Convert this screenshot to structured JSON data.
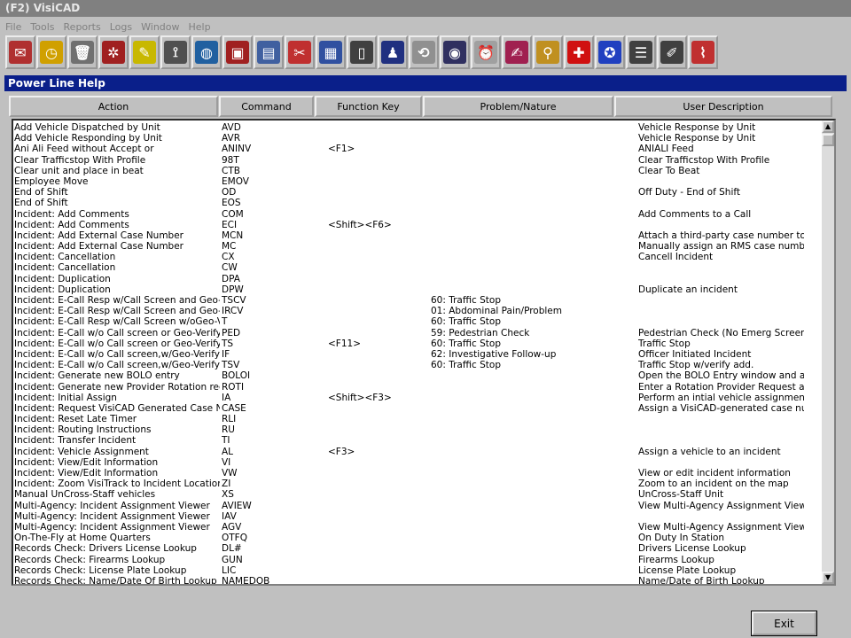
{
  "window": {
    "title": "(F2)  VisiCAD"
  },
  "menu": [
    "File",
    "Tools",
    "Reports",
    "Logs",
    "Window",
    "Help"
  ],
  "toolbar_icons": [
    {
      "name": "dispatch-icon",
      "glyph": "✉",
      "color": "#b03030"
    },
    {
      "name": "clock-icon",
      "glyph": "◷",
      "color": "#d0a000"
    },
    {
      "name": "trash-icon",
      "glyph": "🗑",
      "color": "#707070"
    },
    {
      "name": "network-icon",
      "glyph": "✲",
      "color": "#a02020"
    },
    {
      "name": "highlighter-icon",
      "glyph": "✎",
      "color": "#c8b800"
    },
    {
      "name": "radio-tower-icon",
      "glyph": "⟟",
      "color": "#505050"
    },
    {
      "name": "globe-icon",
      "glyph": "◍",
      "color": "#2060a0"
    },
    {
      "name": "station-icon",
      "glyph": "▣",
      "color": "#a02020"
    },
    {
      "name": "files-icon",
      "glyph": "▤",
      "color": "#4060a0"
    },
    {
      "name": "tools-icon",
      "glyph": "✂",
      "color": "#c03030"
    },
    {
      "name": "report-icon",
      "glyph": "▦",
      "color": "#3050a0"
    },
    {
      "name": "book-icon",
      "glyph": "▯",
      "color": "#404040"
    },
    {
      "name": "people-icon",
      "glyph": "♟",
      "color": "#203080"
    },
    {
      "name": "recycle-icon",
      "glyph": "⟲",
      "color": "#909090"
    },
    {
      "name": "eye-icon",
      "glyph": "◉",
      "color": "#303060"
    },
    {
      "name": "alarm-icon",
      "glyph": "⏰",
      "color": "#a0a0a0"
    },
    {
      "name": "edit-icon",
      "glyph": "✍",
      "color": "#a02050"
    },
    {
      "name": "search-person-icon",
      "glyph": "⚲",
      "color": "#c09020"
    },
    {
      "name": "medical-cross-icon",
      "glyph": "✚",
      "color": "#d01010"
    },
    {
      "name": "police-badge-icon",
      "glyph": "✪",
      "color": "#2040c0"
    },
    {
      "name": "list-icon",
      "glyph": "☰",
      "color": "#404040"
    },
    {
      "name": "document-pen-icon",
      "glyph": "✐",
      "color": "#404040"
    },
    {
      "name": "chart-icon",
      "glyph": "⌇",
      "color": "#c03030"
    }
  ],
  "panel": {
    "title": "Power Line Help"
  },
  "columns": [
    "Action",
    "Command",
    "Function Key",
    "Problem/Nature",
    "User Description"
  ],
  "rows": [
    {
      "action": "Add Vehicle Dispatched by Unit",
      "command": "AVD",
      "fkey": "",
      "problem": "",
      "desc": "Vehicle Response by Unit"
    },
    {
      "action": "Add Vehicle Responding by Unit",
      "command": "AVR",
      "fkey": "",
      "problem": "",
      "desc": "Vehicle Response by Unit"
    },
    {
      "action": "Ani Ali Feed without Accept or",
      "command": "ANINV",
      "fkey": "<F1>",
      "problem": "",
      "desc": "ANIALI Feed"
    },
    {
      "action": "Clear Trafficstop With Profile",
      "command": "98T",
      "fkey": "",
      "problem": "",
      "desc": "Clear Trafficstop With Profile"
    },
    {
      "action": "Clear unit and place in beat",
      "command": "CTB",
      "fkey": "",
      "problem": "",
      "desc": "Clear To Beat"
    },
    {
      "action": "Employee Move",
      "command": "EMOV",
      "fkey": "",
      "problem": "",
      "desc": ""
    },
    {
      "action": "End of Shift",
      "command": "OD",
      "fkey": "",
      "problem": "",
      "desc": "Off Duty - End of Shift"
    },
    {
      "action": "End of Shift",
      "command": "EOS",
      "fkey": "",
      "problem": "",
      "desc": ""
    },
    {
      "action": "Incident: Add Comments",
      "command": "COM",
      "fkey": "",
      "problem": "",
      "desc": "Add Comments to a Call"
    },
    {
      "action": "Incident: Add Comments",
      "command": "ECI",
      "fkey": "<Shift><F6>",
      "problem": "",
      "desc": ""
    },
    {
      "action": "Incident: Add External Case Number",
      "command": "MCN",
      "fkey": "",
      "problem": "",
      "desc": "Attach a third-party case number to an inc"
    },
    {
      "action": "Incident: Add External Case Number",
      "command": "MC",
      "fkey": "",
      "problem": "",
      "desc": "Manually assign an RMS case number to a"
    },
    {
      "action": "Incident: Cancellation",
      "command": "CX",
      "fkey": "",
      "problem": "",
      "desc": "Cancell Incident"
    },
    {
      "action": "Incident: Cancellation",
      "command": "CW",
      "fkey": "",
      "problem": "",
      "desc": ""
    },
    {
      "action": "Incident: Duplication",
      "command": "DPA",
      "fkey": "",
      "problem": "",
      "desc": ""
    },
    {
      "action": "Incident: Duplication",
      "command": "DPW",
      "fkey": "",
      "problem": "",
      "desc": "Duplicate an incident"
    },
    {
      "action": "Incident: E-Call Resp w/Call Screen and Geo-Verify",
      "command": "TSCV",
      "fkey": "",
      "problem": "60: Traffic Stop",
      "desc": ""
    },
    {
      "action": "Incident: E-Call Resp w/Call Screen and Geo-Verify",
      "command": "IRCV",
      "fkey": "",
      "problem": "01: Abdominal Pain/Problem",
      "desc": ""
    },
    {
      "action": "Incident: E-Call Resp w/Call Screen w/oGeo-Verify",
      "command": "T",
      "fkey": "",
      "problem": "60: Traffic Stop",
      "desc": ""
    },
    {
      "action": "Incident: E-Call w/o Call screen or Geo-Verify",
      "command": "PED",
      "fkey": "",
      "problem": "59: Pedestrian Check",
      "desc": "Pedestrian Check (No Emerg Screen or Ve"
    },
    {
      "action": "Incident: E-Call w/o Call screen or Geo-Verify",
      "command": "TS",
      "fkey": "<F11>",
      "problem": "60: Traffic Stop",
      "desc": "Traffic Stop"
    },
    {
      "action": "Incident: E-Call w/o Call screen,w/Geo-Verify",
      "command": "IF",
      "fkey": "",
      "problem": "62: Investigative Follow-up",
      "desc": "Officer Initiated Incident"
    },
    {
      "action": "Incident: E-Call w/o Call screen,w/Geo-Verify",
      "command": "TSV",
      "fkey": "",
      "problem": "60: Traffic Stop",
      "desc": "Traffic Stop w/verify add."
    },
    {
      "action": "Incident: Generate new BOLO entry",
      "command": "BOLOI",
      "fkey": "",
      "problem": "",
      "desc": "Open the BOLO Entry window and automa"
    },
    {
      "action": "Incident: Generate new Provider Rotation request",
      "command": "ROTI",
      "fkey": "",
      "problem": "",
      "desc": "Enter a Rotation Provider  Request and au"
    },
    {
      "action": "Incident: Initial Assign",
      "command": "IA",
      "fkey": "<Shift><F3>",
      "problem": "",
      "desc": "Perform an intial vehicle assignment"
    },
    {
      "action": "Incident: Request VisiCAD Generated Case Number",
      "command": "CASE",
      "fkey": "",
      "problem": "",
      "desc": "Assign a VisiCAD-generated case number"
    },
    {
      "action": "Incident: Reset Late Timer",
      "command": "RLI",
      "fkey": "",
      "problem": "",
      "desc": ""
    },
    {
      "action": "Incident: Routing Instructions",
      "command": "RU",
      "fkey": "",
      "problem": "",
      "desc": ""
    },
    {
      "action": "Incident: Transfer Incident",
      "command": "TI",
      "fkey": "",
      "problem": "",
      "desc": ""
    },
    {
      "action": "Incident: Vehicle Assignment",
      "command": "AL",
      "fkey": "<F3>",
      "problem": "",
      "desc": "Assign a vehicle to an incident"
    },
    {
      "action": "Incident: View/Edit Information",
      "command": "VI",
      "fkey": "",
      "problem": "",
      "desc": ""
    },
    {
      "action": "Incident: View/Edit Information",
      "command": "VW",
      "fkey": "",
      "problem": "",
      "desc": "View or edit incident information"
    },
    {
      "action": "Incident: Zoom VisiTrack to Incident Location",
      "command": "ZI",
      "fkey": "",
      "problem": "",
      "desc": "Zoom to an incident on the map"
    },
    {
      "action": "Manual UnCross-Staff vehicles",
      "command": "XS",
      "fkey": "",
      "problem": "",
      "desc": "UnCross-Staff Unit"
    },
    {
      "action": "Multi-Agency: Incident Assignment Viewer",
      "command": "AVIEW",
      "fkey": "",
      "problem": "",
      "desc": "View Multi-Agency Assignment Viewer"
    },
    {
      "action": "Multi-Agency: Incident Assignment Viewer",
      "command": "IAV",
      "fkey": "",
      "problem": "",
      "desc": ""
    },
    {
      "action": "Multi-Agency: Incident Assignment Viewer",
      "command": "AGV",
      "fkey": "",
      "problem": "",
      "desc": "View Multi-Agency Assignment Viewer"
    },
    {
      "action": "On-The-Fly at Home Quarters",
      "command": "OTFQ",
      "fkey": "",
      "problem": "",
      "desc": "On Duty In Station"
    },
    {
      "action": "Records Check: Drivers License Lookup",
      "command": "DL#",
      "fkey": "",
      "problem": "",
      "desc": "Drivers License Lookup"
    },
    {
      "action": "Records Check: Firearms Lookup",
      "command": "GUN",
      "fkey": "",
      "problem": "",
      "desc": "Firearms Lookup"
    },
    {
      "action": "Records Check: License Plate Lookup",
      "command": "LIC",
      "fkey": "",
      "problem": "",
      "desc": "License Plate Lookup"
    },
    {
      "action": "Records Check: Name/Date Of Birth Lookup",
      "command": "NAMEDOB",
      "fkey": "",
      "problem": "",
      "desc": "Name/Date of Birth Lookup"
    }
  ],
  "buttons": {
    "exit": "Exit"
  }
}
